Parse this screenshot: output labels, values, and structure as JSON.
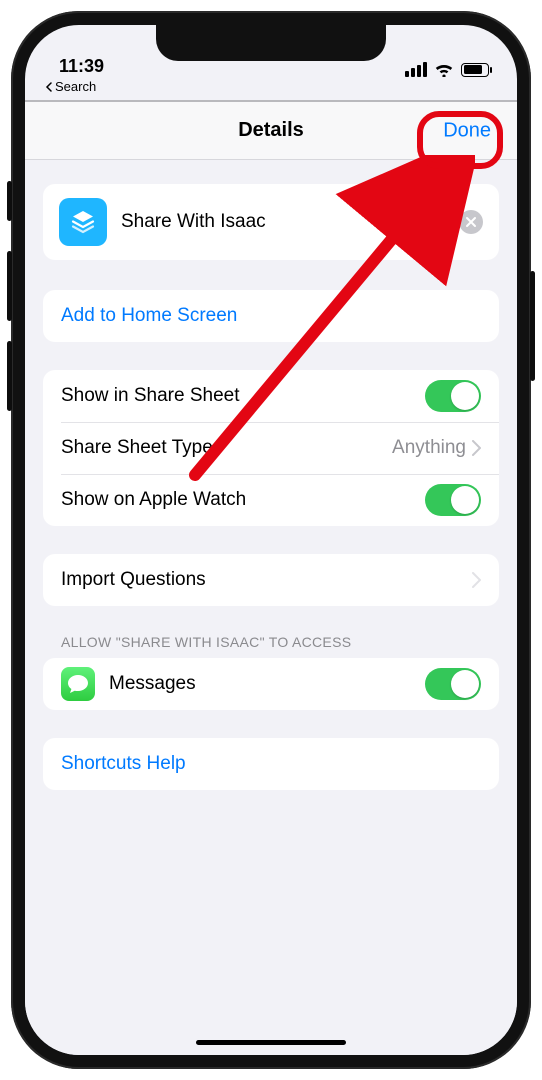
{
  "status": {
    "time": "11:39",
    "back_label": "Search"
  },
  "nav": {
    "title": "Details",
    "done": "Done"
  },
  "shortcut": {
    "name": "Share With Isaac"
  },
  "actions": {
    "add_home": "Add to Home Screen"
  },
  "share": {
    "show_share_sheet": "Show in Share Sheet",
    "types_label": "Share Sheet Types",
    "types_value": "Anything",
    "apple_watch": "Show on Apple Watch"
  },
  "import_q": "Import Questions",
  "permissions": {
    "header": "ALLOW \"SHARE WITH ISAAC\" TO ACCESS",
    "messages": "Messages"
  },
  "help": "Shortcuts Help"
}
